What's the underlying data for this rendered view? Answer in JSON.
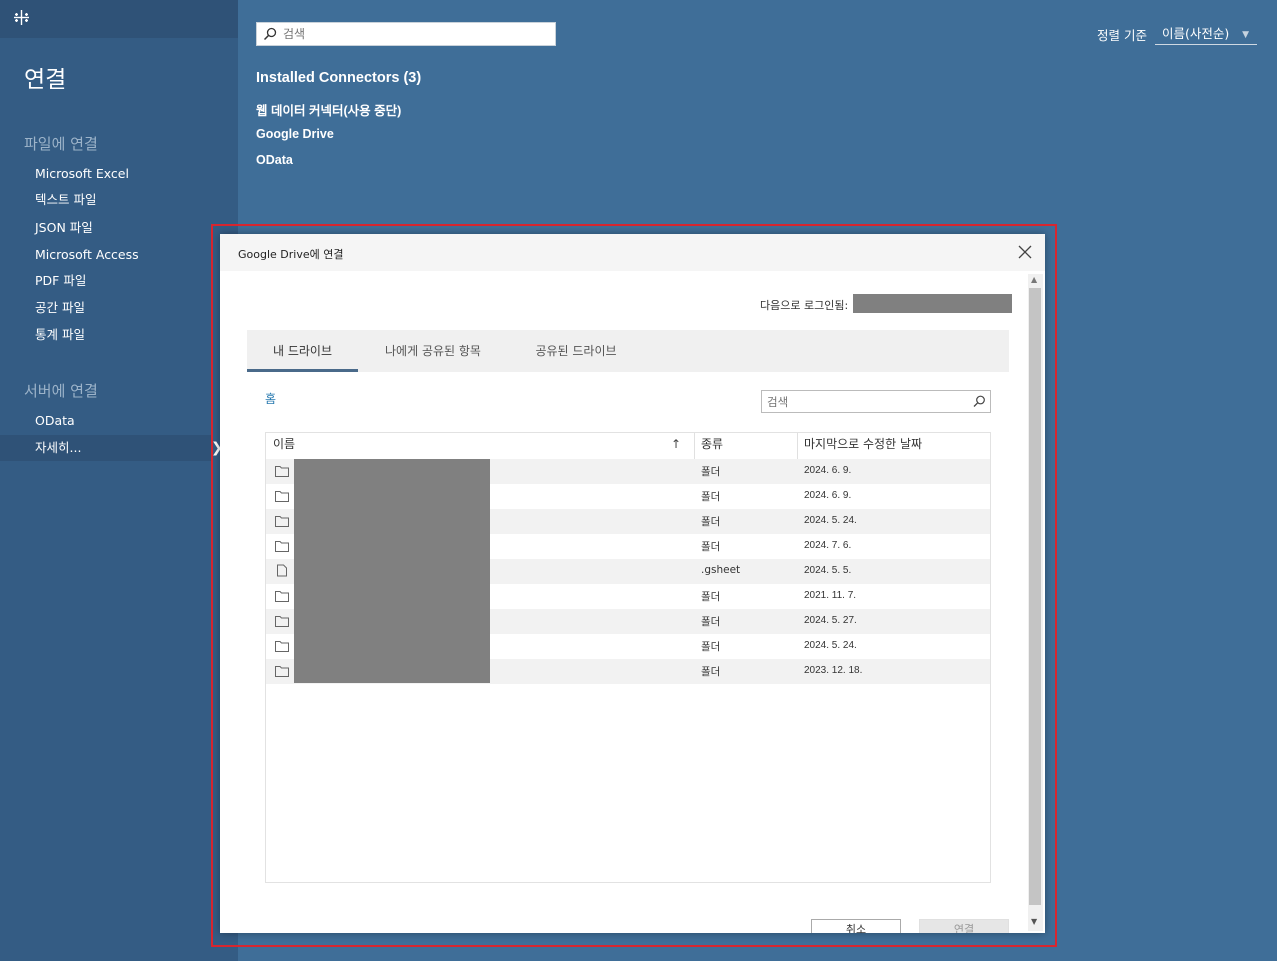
{
  "sidebar": {
    "title": "연결",
    "file_section": "파일에 연결",
    "file_items": [
      "Microsoft Excel",
      "텍스트 파일",
      "JSON 파일",
      "Microsoft Access",
      "PDF 파일",
      "공간 파일",
      "통계 파일"
    ],
    "server_section": "서버에 연결",
    "server_items": [
      "OData",
      "자세히..."
    ]
  },
  "search": {
    "placeholder": "검색"
  },
  "sort": {
    "label": "정렬 기준",
    "value": "이름(사전순)"
  },
  "connectors": {
    "heading": "Installed Connectors (3)",
    "items": [
      "웹 데이터 커넥터(사용 중단)",
      "Google Drive",
      "OData"
    ]
  },
  "dialog": {
    "title": "Google Drive에 연결",
    "login_label": "다음으로 로그인됨:",
    "tabs": [
      "내 드라이브",
      "나에게 공유된 항목",
      "공유된 드라이브"
    ],
    "breadcrumb": "홈",
    "search_placeholder": "검색",
    "columns": {
      "name": "이름",
      "type": "종류",
      "modified": "마지막으로 수정한 날짜"
    },
    "rows": [
      {
        "icon": "folder-icon",
        "type": "폴더",
        "date": "2024. 6. 9."
      },
      {
        "icon": "folder-icon",
        "type": "폴더",
        "date": "2024. 6. 9."
      },
      {
        "icon": "folder-icon",
        "type": "폴더",
        "date": "2024. 5. 24."
      },
      {
        "icon": "folder-icon",
        "type": "폴더",
        "date": "2024. 7. 6."
      },
      {
        "icon": "file-icon",
        "type": ".gsheet",
        "date": "2024. 5. 5."
      },
      {
        "icon": "folder-icon",
        "type": "폴더",
        "date": "2021. 11. 7."
      },
      {
        "icon": "folder-icon",
        "type": "폴더",
        "date": "2024. 5. 27."
      },
      {
        "icon": "folder-icon",
        "type": "폴더",
        "date": "2024. 5. 24."
      },
      {
        "icon": "folder-icon",
        "type": "폴더",
        "date": "2023. 12. 18."
      }
    ],
    "cancel_label": "취소",
    "connect_label": "연결"
  },
  "colors": {
    "background": "#3f6e98",
    "sidebar": "#345c84",
    "highlight": "#d8262f"
  }
}
